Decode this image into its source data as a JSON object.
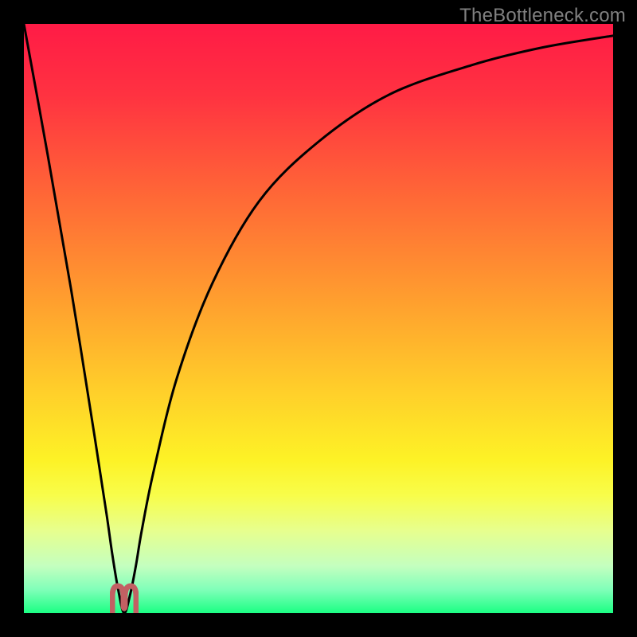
{
  "attribution": "TheBottleneck.com",
  "colors": {
    "frame": "#000000",
    "attribution_text": "#808080",
    "curve": "#000000",
    "marker": "#c26063",
    "gradient_stops": [
      {
        "offset": 0.0,
        "color": "#ff1b46"
      },
      {
        "offset": 0.12,
        "color": "#ff3241"
      },
      {
        "offset": 0.3,
        "color": "#ff6a36"
      },
      {
        "offset": 0.48,
        "color": "#ffa22e"
      },
      {
        "offset": 0.62,
        "color": "#ffce2a"
      },
      {
        "offset": 0.74,
        "color": "#fdf226"
      },
      {
        "offset": 0.8,
        "color": "#f8fd4a"
      },
      {
        "offset": 0.86,
        "color": "#e7ff8e"
      },
      {
        "offset": 0.92,
        "color": "#c4ffbf"
      },
      {
        "offset": 0.96,
        "color": "#80ffb9"
      },
      {
        "offset": 1.0,
        "color": "#1bff83"
      }
    ]
  },
  "chart_data": {
    "type": "line",
    "title": "",
    "xlabel": "",
    "ylabel": "",
    "xlim": [
      0,
      100
    ],
    "ylim": [
      0,
      100
    ],
    "grid": false,
    "legend": false,
    "optimum_x": 17,
    "series": [
      {
        "name": "bottleneck-curve",
        "x": [
          0,
          4,
          8,
          12,
          14,
          15,
          16,
          17,
          18,
          19,
          20,
          22,
          26,
          32,
          40,
          50,
          62,
          76,
          88,
          100
        ],
        "y": [
          100,
          78,
          55,
          30,
          17,
          10,
          4,
          0,
          3,
          8,
          14,
          24,
          40,
          56,
          70,
          80,
          88,
          93,
          96,
          98
        ]
      }
    ],
    "annotations": []
  }
}
